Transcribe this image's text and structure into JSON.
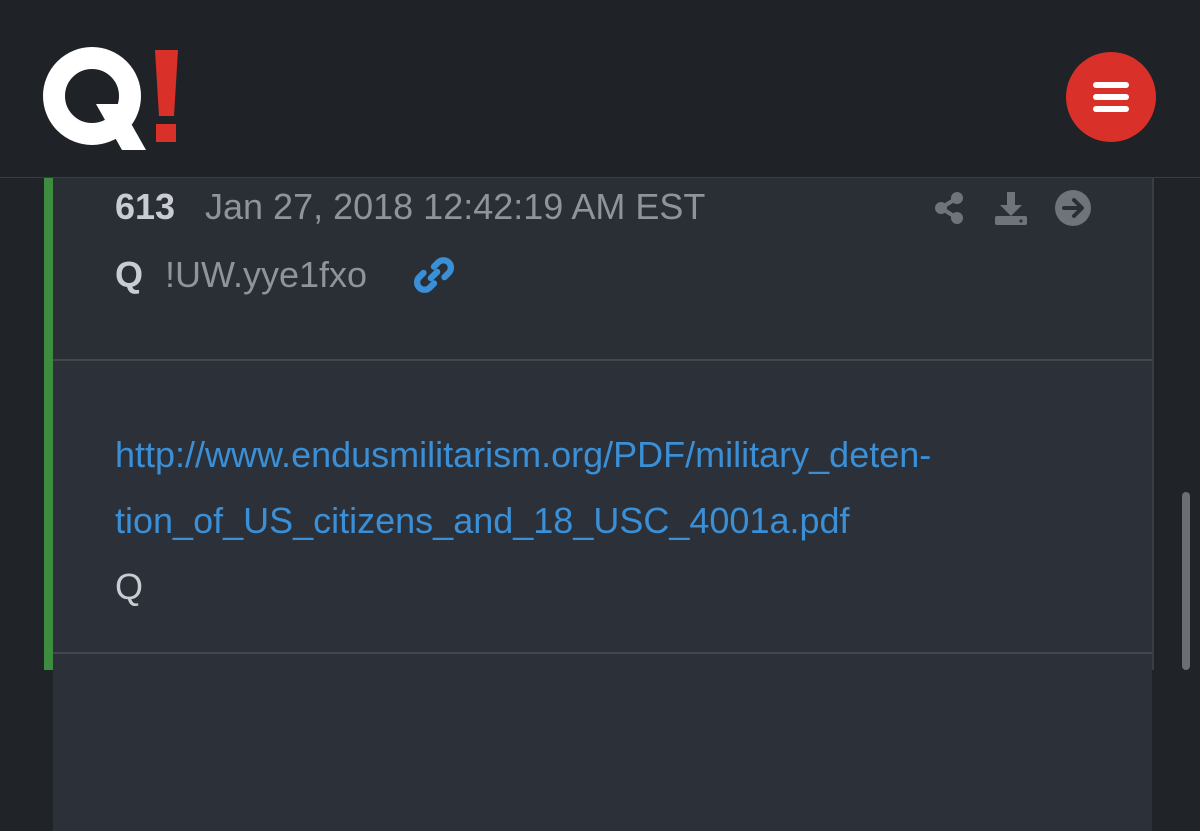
{
  "header": {
    "logo_text": "Q!",
    "menu_icon": "hamburger-icon",
    "brand_red": "#d9312a"
  },
  "post": {
    "number": "613",
    "date": "Jan 27, 2018 12:42:19 AM EST",
    "author": "Q",
    "tripcode": "!UW.yye1fxo",
    "icons": [
      "share-icon",
      "download-icon",
      "arrow-right-icon",
      "link-icon"
    ],
    "body": {
      "url_line_1": "http://www.endusmilitarism.org/PDF/military_deten-",
      "url_line_2": "tion_of_US_citizens_and_18_USC_4001a.pdf",
      "signature": "Q"
    },
    "accent_color": "#3d8c3f",
    "link_color": "#3a8fd6"
  }
}
